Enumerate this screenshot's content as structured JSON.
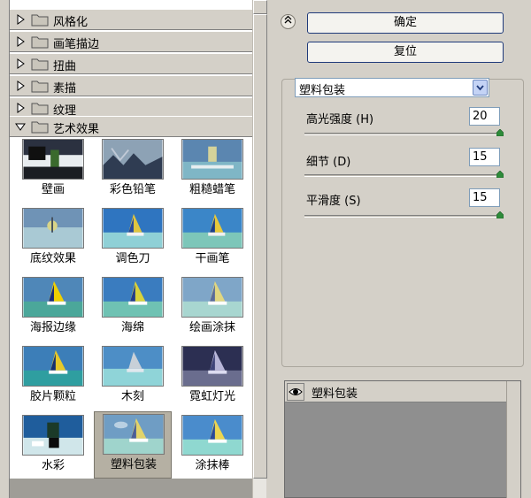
{
  "gallery": {
    "categories": [
      {
        "label": "风格化",
        "expanded": false
      },
      {
        "label": "画笔描边",
        "expanded": false
      },
      {
        "label": "扭曲",
        "expanded": false
      },
      {
        "label": "素描",
        "expanded": false
      },
      {
        "label": "纹理",
        "expanded": false
      },
      {
        "label": "艺术效果",
        "expanded": true
      }
    ],
    "thumbnails": [
      {
        "label": "壁画"
      },
      {
        "label": "彩色铅笔"
      },
      {
        "label": "粗糙蜡笔"
      },
      {
        "label": "底纹效果"
      },
      {
        "label": "调色刀"
      },
      {
        "label": "干画笔"
      },
      {
        "label": "海报边缘"
      },
      {
        "label": "海绵"
      },
      {
        "label": "绘画涂抹"
      },
      {
        "label": "胶片颗粒"
      },
      {
        "label": "木刻"
      },
      {
        "label": "霓虹灯光"
      },
      {
        "label": "水彩"
      },
      {
        "label": "塑料包装",
        "selected": true
      },
      {
        "label": "涂抹棒"
      }
    ]
  },
  "buttons": {
    "ok_label": "确定",
    "reset_label": "复位"
  },
  "options": {
    "selected_filter": "塑料包装",
    "params": [
      {
        "label": "高光强度 (H)",
        "value": "20",
        "level": 1.0
      },
      {
        "label": "细节 (D)",
        "value": "15",
        "level": 1.0
      },
      {
        "label": "平滑度 (S)",
        "value": "15",
        "level": 1.0
      }
    ]
  },
  "layers": {
    "items": [
      {
        "label": "塑料包装"
      }
    ]
  },
  "colors": {
    "panel_bg": "#d4d0c8",
    "gallery_bg": "#ffffff",
    "button_border": "#1f3a7a",
    "select_arrow": "#c4d3f5",
    "preview_gray": "#8f8f8f"
  },
  "icons": [
    "triangle-right-icon",
    "triangle-down-icon",
    "folder-icon",
    "collapse-arrows-icon",
    "chevron-down-icon",
    "eye-icon",
    "slider-knob-icon"
  ]
}
